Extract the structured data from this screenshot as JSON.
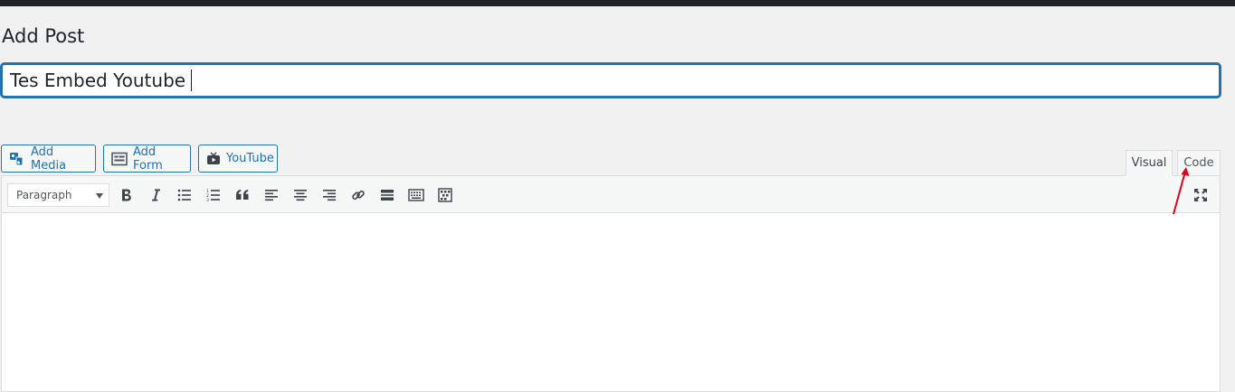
{
  "page": {
    "title": "Add Post"
  },
  "post_title": {
    "value": "Tes Embed Youtube"
  },
  "media_buttons": [
    {
      "label": "Add Media",
      "icon": "media-icon"
    },
    {
      "label": "Add Form",
      "icon": "form-icon"
    },
    {
      "label": "YouTube",
      "icon": "youtube-icon"
    }
  ],
  "editor_tabs": {
    "visual": "Visual",
    "code": "Code",
    "active": "Visual"
  },
  "toolbar": {
    "format_select": "Paragraph",
    "buttons": [
      "bold-icon",
      "italic-icon",
      "bulleted-list-icon",
      "numbered-list-icon",
      "blockquote-icon",
      "align-left-icon",
      "align-center-icon",
      "align-right-icon",
      "link-icon",
      "read-more-icon",
      "toolbar-toggle-icon",
      "embed-icon",
      "fullscreen-icon"
    ]
  },
  "colors": {
    "accent": "#2271b1",
    "annotation": "#e0001b",
    "adminbar": "#1d2327"
  }
}
